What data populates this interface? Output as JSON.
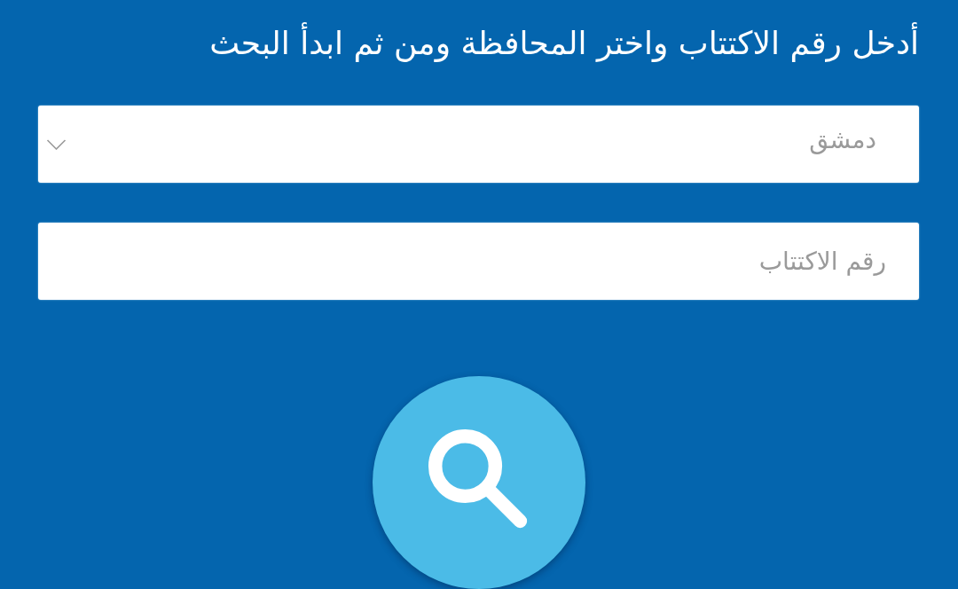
{
  "instructions": "أدخل رقم الاكتتاب واختر المحافظة ومن ثم ابدأ البحث",
  "governorate_select": {
    "value": "دمشق"
  },
  "subscription_number_field": {
    "placeholder": "رقم الاكتتاب"
  }
}
